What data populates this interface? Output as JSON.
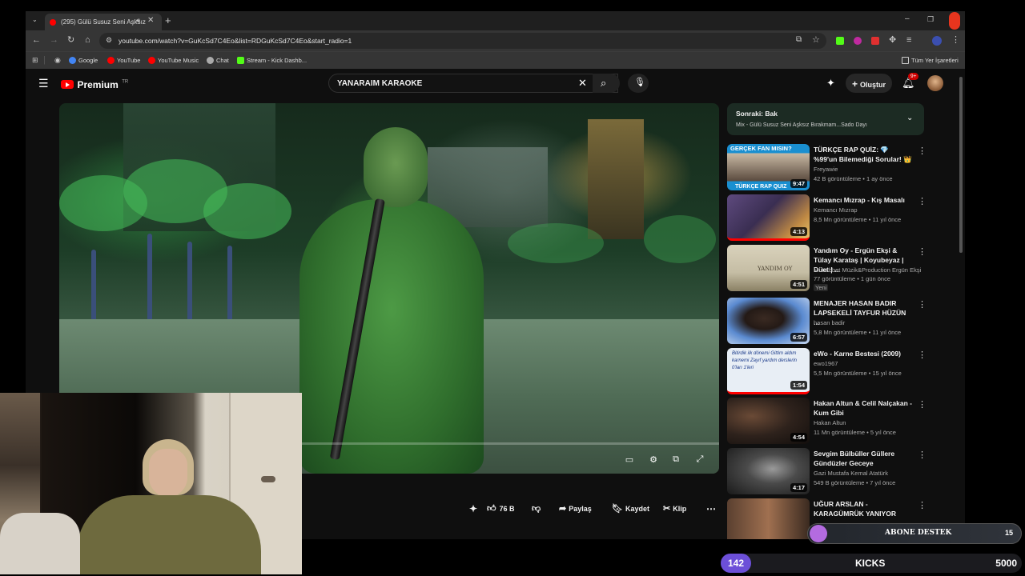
{
  "browser": {
    "tab_title": "(295) Gülü Susuz Seni Aşksız",
    "url": "youtube.com/watch?v=GuKcSd7C4Eo&list=RDGuKcSd7C4Eo&start_radio=1",
    "bookmarks": [
      "Google",
      "YouTube",
      "YouTube Music",
      "Chat",
      "Stream - Kick Dashb..."
    ],
    "all_bookmarks_label": "Tüm Yer İşaretleri"
  },
  "youtube": {
    "logo_label": "Premium",
    "logo_superscript": "TR",
    "search_value": "YANARAIM KARAOKE",
    "create_label": "Oluştur",
    "notification_count": "9+",
    "actions": {
      "like_count": "76 B",
      "share_label": "Paylaş",
      "save_label": "Kaydet",
      "clip_label": "Klip"
    },
    "playback_progress": 0.16,
    "up_next": {
      "title": "Sonraki: Bak",
      "subtitle": "Mix - Gülü Susuz Seni Aşksız Bırakmam...Sado Dayı"
    },
    "recommendations": [
      {
        "title": "TÜRKÇE RAP QUİZ: 💎 %99'un Bilemediği Sorular! 👑",
        "channel": "Freyawie",
        "meta": "42 B görüntüleme • 1 ay önce",
        "duration": "9:47",
        "thumb_text": "GERÇEK FAN MISIN?",
        "thumb_text2": "TÜRKÇE RAP QUIZ"
      },
      {
        "title": "Kemancı Mızrap - Kış Masalı",
        "channel": "Kemancı Mızrap",
        "meta": "8,5 Mn görüntüleme • 11 yıl önce",
        "duration": "4:13"
      },
      {
        "title": "Yandım Oy - Ergün Ekşi & Tülay Karataş | Koyubeyaz | Düet | ...",
        "channel": "Muhabbet Müzik&Production Ergün Ekşi",
        "meta": "77 görüntüleme • 1 gün önce",
        "badge": "Yeni",
        "duration": "4:51",
        "thumb_text": "YANDIM OY"
      },
      {
        "title": "MENAJER HASAN BADIR LAPSEKELİ TAYFUR HÜZÜN ...",
        "channel": "hasan badir",
        "meta": "5,8 Mn görüntüleme • 11 yıl önce",
        "duration": "6:57"
      },
      {
        "title": "eWo - Karne Bestesi (2009)",
        "channel": "ewo1967",
        "meta": "5,5 Mn görüntüleme • 15 yıl önce",
        "duration": "1:54",
        "thumb_text": "Bitirdik ilk dönemi Gittim aldım karnemi Zayıf yardım derslerin 0'ları 1'leri"
      },
      {
        "title": "Hakan Altun & Celil Nalçakan - Kum Gibi",
        "channel": "Hakan Altun",
        "meta": "11 Mn görüntüleme • 5 yıl önce",
        "duration": "4:54"
      },
      {
        "title": "Sevgim  Bülbüller Güllere Gündüzler Geceye",
        "channel": "Gazi Mustafa Kemal Atatürk",
        "meta": "549 B görüntüleme • 7 yıl önce",
        "duration": "4:17"
      },
      {
        "title": "UĞUR ARSLAN - KARAGÜMRÜK YANIYOR",
        "channel": "",
        "meta": "",
        "duration": ""
      }
    ]
  },
  "overlay": {
    "abone_label": "ABONE DESTEK",
    "abone_count": "15",
    "kicks_count": "142",
    "kicks_label": "KICKS",
    "kicks_goal": "5000"
  },
  "colors": {
    "youtube_red": "#ff0000",
    "kick_green": "#53fc18",
    "kick_purple": "#6c4fd8"
  }
}
